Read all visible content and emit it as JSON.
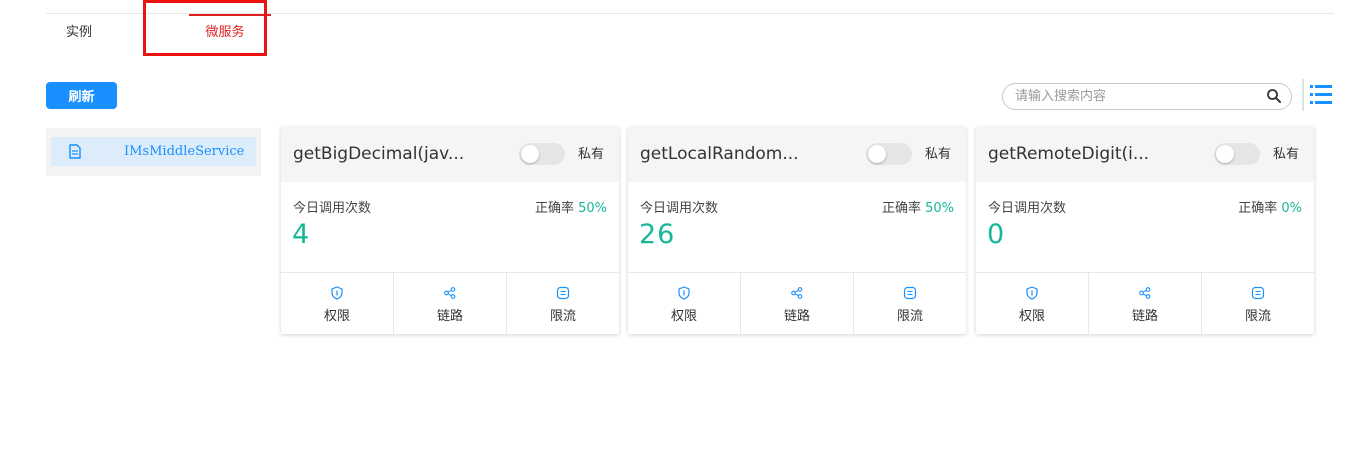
{
  "tabs": [
    {
      "label": "实例"
    },
    {
      "label": "微服务"
    }
  ],
  "toolbar": {
    "refresh_label": "刷新",
    "search_placeholder": "请输入搜索内容"
  },
  "sidebar": {
    "items": [
      {
        "label": "IMsMiddleService",
        "icon": "document-icon"
      }
    ]
  },
  "colors": {
    "primary": "#1890ff",
    "accent_green": "#17b897",
    "highlight_red": "#ee1111"
  },
  "card_labels": {
    "private": "私有",
    "calls_today": "今日调用次数",
    "accuracy": "正确率",
    "permission": "权限",
    "trace": "链路",
    "ratelimit": "限流"
  },
  "cards": [
    {
      "title": "getBigDecimal(jav...",
      "calls": "4",
      "rate": "50%",
      "private_enabled": false
    },
    {
      "title": "getLocalRandom...",
      "calls": "26",
      "rate": "50%",
      "private_enabled": false
    },
    {
      "title": "getRemoteDigit(i...",
      "calls": "0",
      "rate": "0%",
      "private_enabled": false
    }
  ]
}
